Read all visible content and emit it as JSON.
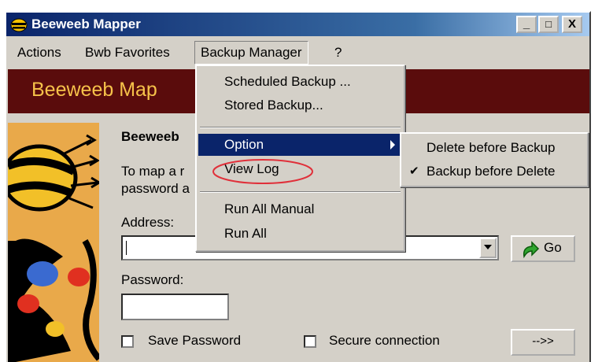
{
  "window": {
    "title": "Beeweeb Mapper",
    "minimize": "_",
    "maximize": "□",
    "close": "X"
  },
  "menubar": {
    "items": [
      {
        "label": "Actions"
      },
      {
        "label": "Bwb Favorites"
      },
      {
        "label": "Backup Manager"
      },
      {
        "label": "?"
      }
    ]
  },
  "banner": {
    "title": "Beeweeb Map"
  },
  "content": {
    "heading": "Beeweeb",
    "instruction_line1": "To map a r",
    "instruction_line2": "password a",
    "address_label": "Address:",
    "address_value": "",
    "go_label": "Go",
    "password_label": "Password:",
    "password_value": "",
    "save_password_label": "Save Password",
    "save_password_checked": false,
    "secure_connection_label": "Secure connection",
    "secure_connection_checked": false,
    "next_label": "-->>"
  },
  "backup_menu": {
    "scheduled": "Scheduled Backup ...",
    "stored": "Stored Backup...",
    "option": "Option",
    "view_log": "View Log",
    "run_all_manual": "Run All Manual",
    "run_all": "Run All"
  },
  "option_submenu": {
    "delete_before": "Delete before Backup",
    "delete_before_checked": false,
    "backup_before": "Backup before Delete",
    "backup_before_checked": true,
    "check_mark": "✔"
  },
  "colors": {
    "title_bar": "#0a246a",
    "banner_bg": "#5a0c0c",
    "banner_text": "#f6c24a",
    "menu_highlight": "#0a246a",
    "annotation_circle": "#e0303a"
  }
}
